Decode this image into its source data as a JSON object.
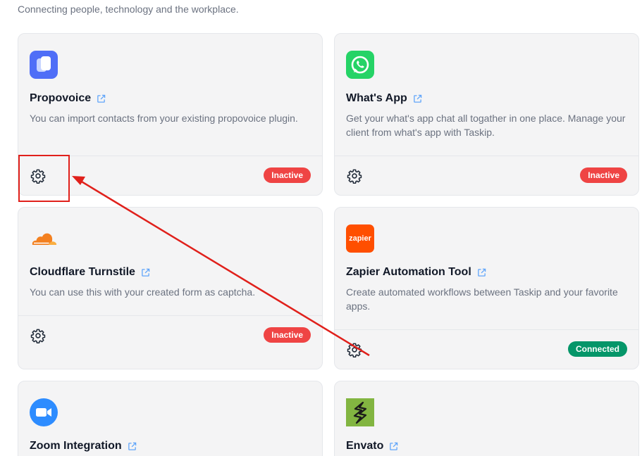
{
  "header": {
    "subtitle": "Connecting people, technology and the workplace."
  },
  "colors": {
    "inactive": "#ef4444",
    "connected": "#059669",
    "annotation": "#e0201b"
  },
  "integrations": [
    {
      "title": "Propovoice",
      "description": "You can import contacts from your existing propovoice plugin.",
      "status": "Inactive",
      "logo_icon": "propovoice-logo",
      "settings_icon": "gear-icon"
    },
    {
      "title": "What's App",
      "description": "Get your what's app chat all togather in one place. Manage your client from what's app with Taskip.",
      "status": "Inactive",
      "logo_icon": "whatsapp-logo",
      "settings_icon": "gear-icon"
    },
    {
      "title": "Cloudflare Turnstile",
      "description": "You can use this with your created form as captcha.",
      "status": "Inactive",
      "logo_icon": "cloudflare-logo",
      "settings_icon": "gear-icon"
    },
    {
      "title": "Zapier Automation Tool",
      "description": "Create automated workflows between Taskip and your favorite apps.",
      "status": "Connected",
      "logo_icon": "zapier-logo",
      "logo_text": "zapier",
      "settings_icon": "gear-icon"
    },
    {
      "title": "Zoom Integration",
      "logo_icon": "zoom-logo"
    },
    {
      "title": "Envato",
      "logo_icon": "envato-logo"
    }
  ]
}
